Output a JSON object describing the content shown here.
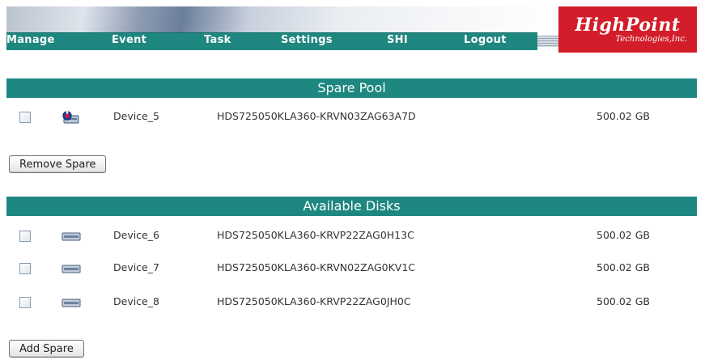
{
  "nav": {
    "items": [
      {
        "label": "Manage"
      },
      {
        "label": "Event"
      },
      {
        "label": "Task"
      },
      {
        "label": "Settings"
      },
      {
        "label": "SHI"
      },
      {
        "label": "Logout"
      }
    ]
  },
  "logo": {
    "name": "HighPoint",
    "tagline": "Technologies,Inc."
  },
  "spare_pool": {
    "title": "Spare Pool",
    "rows": [
      {
        "name": "Device_5",
        "model": "HDS725050KLA360-KRVN03ZAG63A7D",
        "size": "500.02 GB",
        "icon": "spare-disk-icon"
      }
    ],
    "button": "Remove Spare"
  },
  "available": {
    "title": "Available Disks",
    "rows": [
      {
        "name": "Device_6",
        "model": "HDS725050KLA360-KRVP22ZAG0H13C",
        "size": "500.02 GB",
        "icon": "hard-disk-icon"
      },
      {
        "name": "Device_7",
        "model": "HDS725050KLA360-KRVN02ZAG0KV1C",
        "size": "500.02 GB",
        "icon": "hard-disk-icon"
      },
      {
        "name": "Device_8",
        "model": "HDS725050KLA360-KRVP22ZAG0JH0C",
        "size": "500.02 GB",
        "icon": "hard-disk-icon"
      }
    ],
    "button": "Add Spare"
  },
  "colors": {
    "teal": "#1e8780",
    "logo_red": "#d31d2a"
  }
}
